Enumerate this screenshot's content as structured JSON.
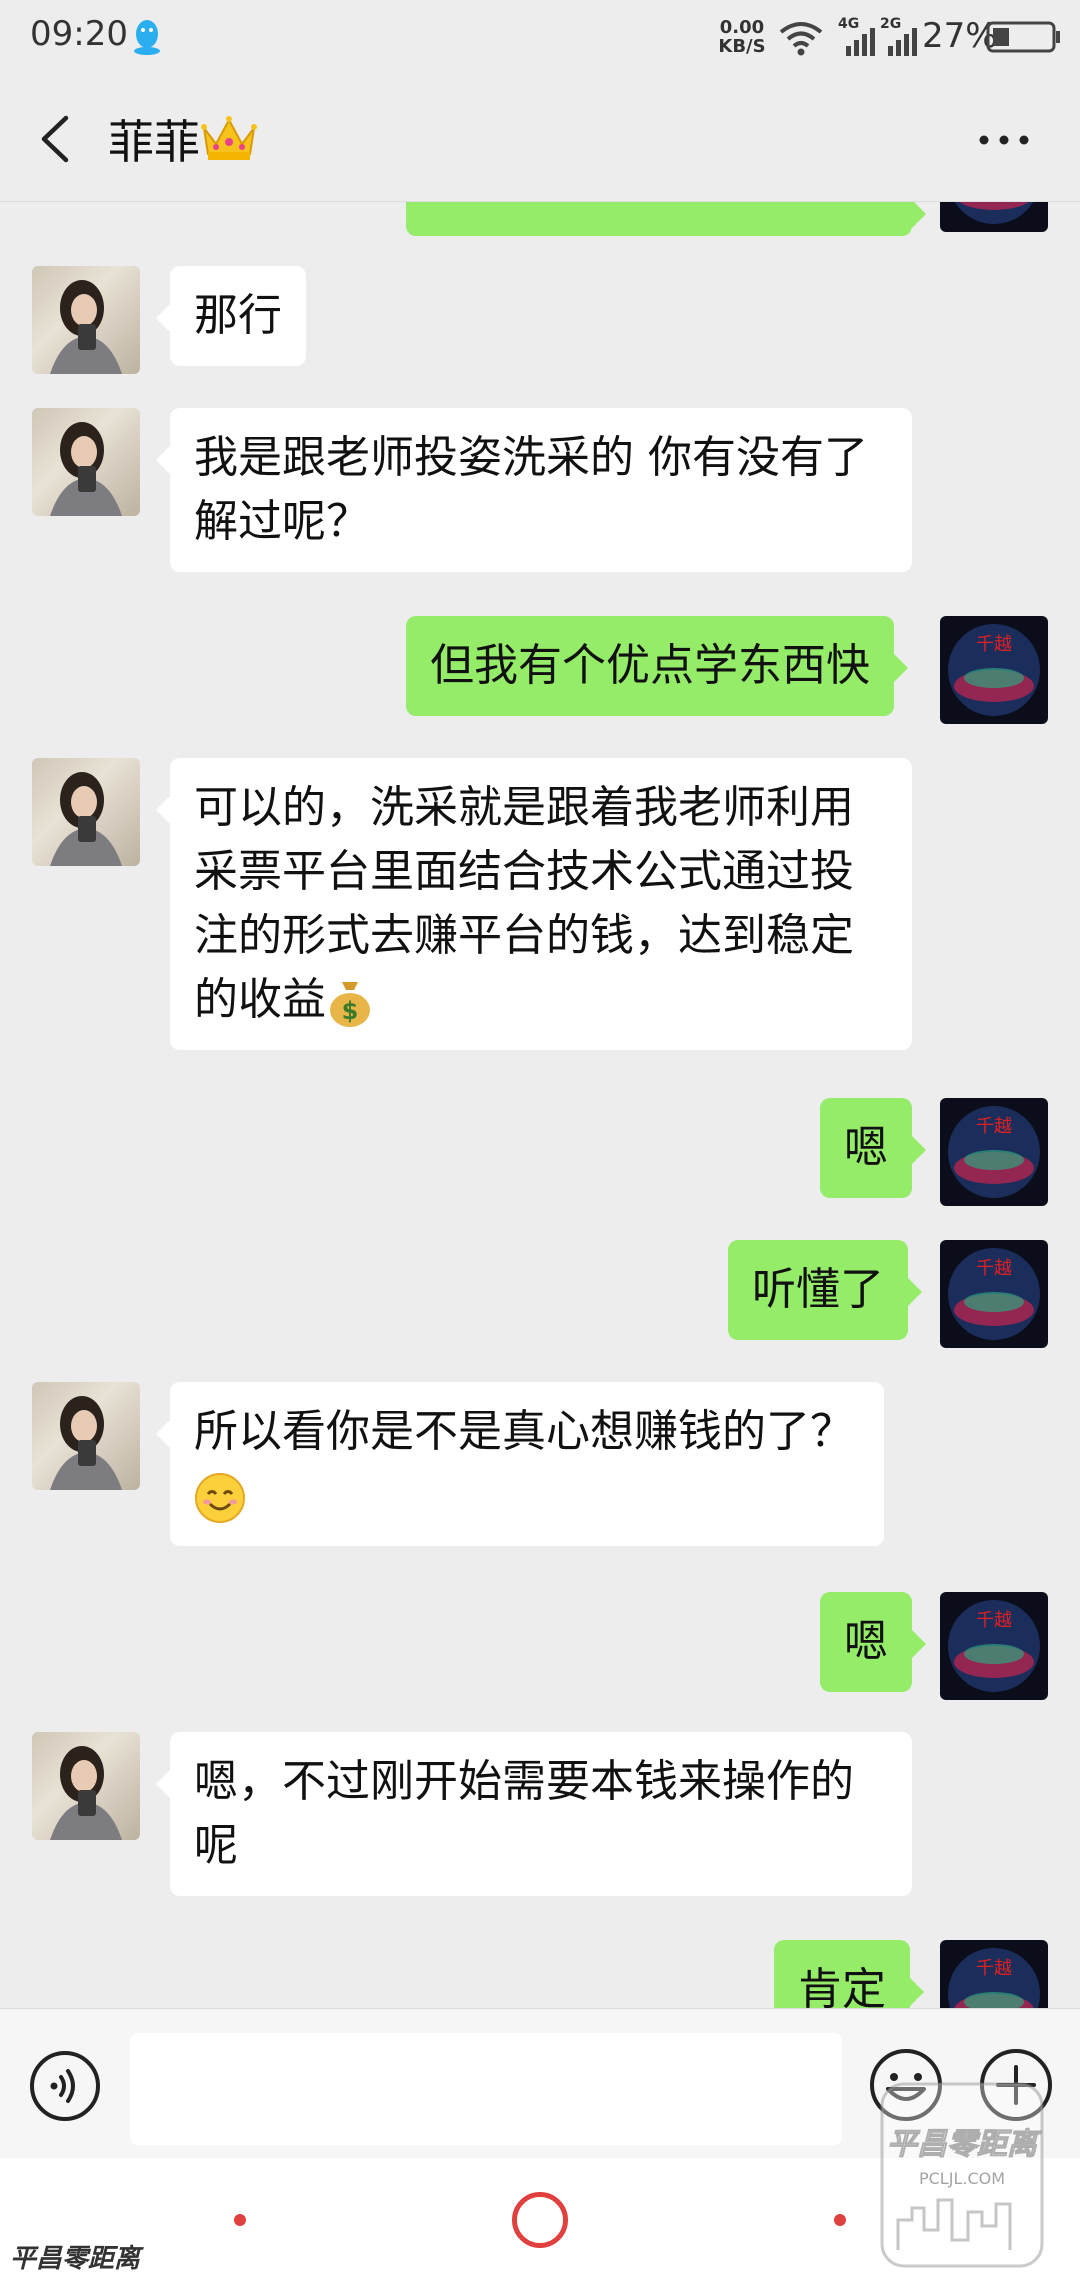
{
  "status_bar": {
    "time": "09:20",
    "net_speed_value": "0.00",
    "net_speed_unit": "KB/S",
    "network_1": "4G",
    "network_2": "2G",
    "battery": "27%"
  },
  "header": {
    "title": "菲菲"
  },
  "messages": [
    {
      "side": "out",
      "text": ""
    },
    {
      "side": "in",
      "text": "那行"
    },
    {
      "side": "in",
      "text": "我是跟老师投姿洗采的 你有没有了解过呢？"
    },
    {
      "side": "out",
      "text": "但我有个优点学东西快"
    },
    {
      "side": "in",
      "text": "可以的，洗采就是跟着我老师利用采票平台里面结合技术公式通过投注的形式去赚平台的钱，达到稳定的收益"
    },
    {
      "side": "out",
      "text": "嗯"
    },
    {
      "side": "out",
      "text": "听懂了"
    },
    {
      "side": "in",
      "text": "所以看你是不是真心想赚钱的了？"
    },
    {
      "side": "out",
      "text": "嗯"
    },
    {
      "side": "in",
      "text": "嗯，不过刚开始需要本钱来操作的呢"
    },
    {
      "side": "out",
      "text": "肯定"
    }
  ],
  "my_avatar_text": "千越",
  "icons": {
    "status_qq": "qq-penguin-icon",
    "wifi": "wifi-icon",
    "signal": "signal-icon",
    "battery": "battery-icon",
    "back": "back-arrow-icon",
    "crown": "crown-icon",
    "more": "more-dots-icon",
    "voice": "voice-icon",
    "emoji": "emoji-icon",
    "plus": "plus-icon",
    "money_bag": "money-bag-emoji",
    "smile": "smiling-face-emoji"
  },
  "colors": {
    "background": "#ededed",
    "bubble_out": "#95ec69",
    "bubble_in": "#ffffff",
    "nav_accent": "#e0403e"
  },
  "watermark": {
    "brand": "平昌零距离",
    "url": "PCLJL.COM"
  }
}
